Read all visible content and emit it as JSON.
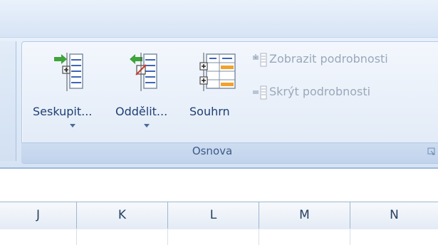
{
  "ribbon": {
    "group_label": "Osnova",
    "buttons": {
      "group": {
        "label": "Seskupit...",
        "icon": "group-rows-icon"
      },
      "ungroup": {
        "label": "Oddělit...",
        "icon": "ungroup-rows-icon"
      },
      "subtotal": {
        "label": "Souhrn",
        "icon": "subtotal-icon"
      },
      "show_detail": {
        "label": "Zobrazit podrobnosti",
        "icon": "show-detail-icon"
      },
      "hide_detail": {
        "label": "Skrýt podrobnosti",
        "icon": "hide-detail-icon"
      }
    },
    "colors": {
      "label_text": "#1f3e73",
      "disabled_text": "#9aa8ba",
      "group_label_text": "#3c5b87",
      "arrow_green": "#3fa43b"
    }
  },
  "sheet": {
    "columns": [
      "J",
      "K",
      "L",
      "M",
      "N"
    ]
  }
}
